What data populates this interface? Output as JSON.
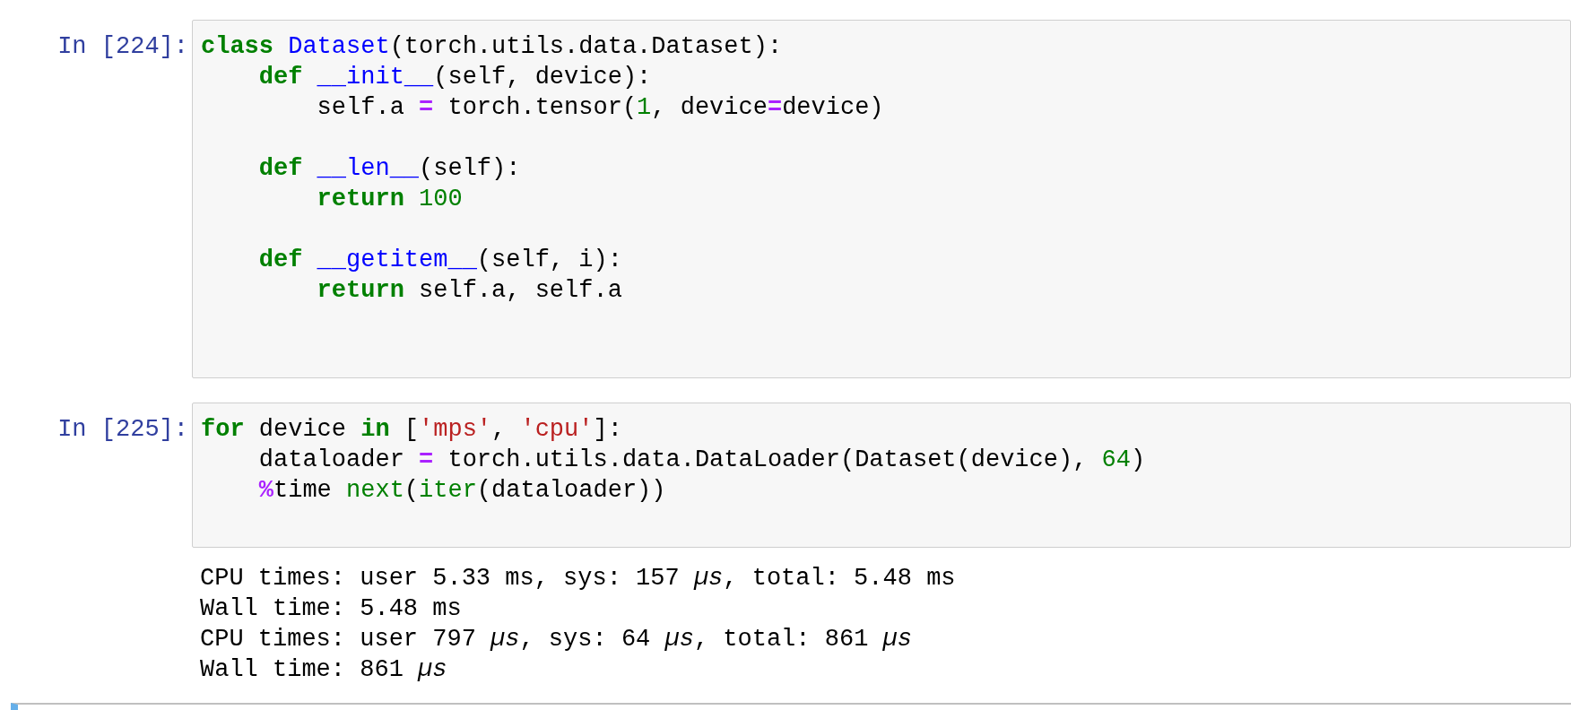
{
  "cells": [
    {
      "prompt": "In [224]:",
      "blocks": [
        [
          [
            {
              "kind": "keyword",
              "text": "class"
            },
            {
              "kind": "name",
              "text": " Dataset"
            },
            {
              "kind": "plain",
              "text": "(torch.utils.data.Dataset):"
            }
          ],
          [
            {
              "kind": "keyword",
              "text": "    def"
            },
            {
              "kind": "name",
              "text": " __init__"
            },
            {
              "kind": "plain",
              "text": "(self, device):"
            }
          ],
          [
            {
              "kind": "plain",
              "text": "        self.a "
            },
            {
              "kind": "operator",
              "text": "="
            },
            {
              "kind": "plain",
              "text": " torch.tensor("
            },
            {
              "kind": "number",
              "text": "1"
            },
            {
              "kind": "plain",
              "text": ", device"
            },
            {
              "kind": "operator",
              "text": "="
            },
            {
              "kind": "plain",
              "text": "device)"
            }
          ]
        ],
        [
          [
            {
              "kind": "keyword",
              "text": "    def"
            },
            {
              "kind": "name",
              "text": " __len__"
            },
            {
              "kind": "plain",
              "text": "(self):"
            }
          ],
          [
            {
              "kind": "keyword",
              "text": "        return"
            },
            {
              "kind": "number",
              "text": " 100"
            }
          ]
        ],
        [
          [
            {
              "kind": "keyword",
              "text": "    def"
            },
            {
              "kind": "name",
              "text": " __getitem__"
            },
            {
              "kind": "plain",
              "text": "(self, i):"
            }
          ],
          [
            {
              "kind": "keyword",
              "text": "        return"
            },
            {
              "kind": "plain",
              "text": " self.a, self.a"
            }
          ]
        ]
      ]
    },
    {
      "prompt": "In [225]:",
      "blocks": [
        [
          [
            {
              "kind": "keyword",
              "text": "for"
            },
            {
              "kind": "plain",
              "text": " device "
            },
            {
              "kind": "keyword",
              "text": "in"
            },
            {
              "kind": "plain",
              "text": " ["
            },
            {
              "kind": "string",
              "text": "'mps'"
            },
            {
              "kind": "plain",
              "text": ", "
            },
            {
              "kind": "string",
              "text": "'cpu'"
            },
            {
              "kind": "plain",
              "text": "]:"
            }
          ],
          [
            {
              "kind": "plain",
              "text": "    dataloader "
            },
            {
              "kind": "operator",
              "text": "="
            },
            {
              "kind": "plain",
              "text": " torch.utils.data.DataLoader(Dataset(device), "
            },
            {
              "kind": "number",
              "text": "64"
            },
            {
              "kind": "plain",
              "text": ")"
            }
          ],
          [
            {
              "kind": "magic",
              "text": "    %"
            },
            {
              "kind": "plain",
              "text": "time "
            },
            {
              "kind": "builtin",
              "text": "next"
            },
            {
              "kind": "plain",
              "text": "("
            },
            {
              "kind": "builtin",
              "text": "iter"
            },
            {
              "kind": "plain",
              "text": "(dataloader))"
            }
          ]
        ]
      ],
      "output": [
        "CPU times: user 5.33 ms, sys: 157 *µs*, total: 5.48 ms",
        "Wall time: 5.48 ms",
        "CPU times: user 797 *µs*, sys: 64 *µs*, total: 861 *µs*",
        "Wall time: 861 *µs*"
      ]
    }
  ],
  "next_cell": {
    "selected": true
  }
}
